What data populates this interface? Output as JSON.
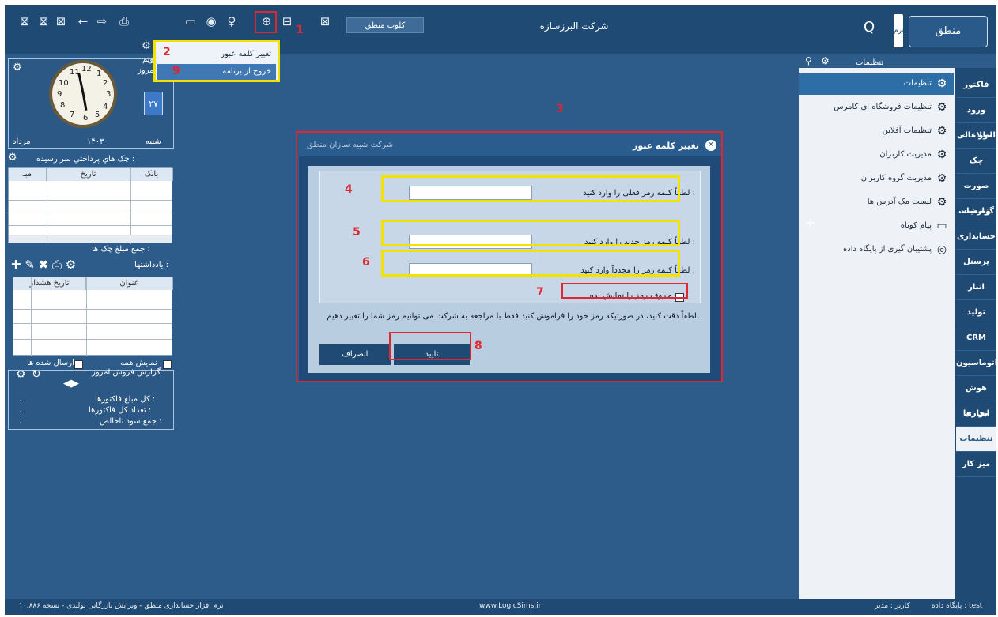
{
  "topbar": {
    "app_title": "شرکت البرزسازه",
    "club_button": "کلوب منطق",
    "logo_text": "منطق",
    "logo_strip": "نرم افزار",
    "icons": [
      "grid-icon",
      "grid-icon",
      "grid-icon",
      "arrow-left-icon",
      "arrow-right-icon",
      "printer-icon",
      "monitor-icon",
      "gamepad-icon",
      "bulb-icon",
      "lock-icon",
      "database-icon",
      "export-icon",
      "search-icon"
    ]
  },
  "user_menu": {
    "items": [
      {
        "label": "تغییر کلمه عبور",
        "selected": false
      },
      {
        "label": "خروج از برنامه",
        "selected": true
      }
    ]
  },
  "annotations": {
    "n1": "1",
    "n2": "2",
    "n3": "3",
    "n4": "4",
    "n5": "5",
    "n6": "6",
    "n7": "7",
    "n8": "8",
    "n9": "9"
  },
  "left_panel": {
    "calendar_label": "تقویم",
    "today_label": "امروز :",
    "day_name": "شنبه",
    "day_number": "۲۷",
    "month_name": "مرداد",
    "year": "۱۴۰۳",
    "cheques_title": "چک هاي پرداختي سر رسيده :",
    "cheques_headers": [
      "بانک",
      "تاريخ",
      "مبـ"
    ],
    "cheques_total_label": "جمع مبلغ چک ها :",
    "notes_title": "يادداشتها :",
    "notes_headers": [
      "عنوان",
      "تاريخ هشدار"
    ],
    "show_all_label": "نمايش همه",
    "sent_label": "ارسال شده ها",
    "sales_title": "گزارش فروش امروز",
    "sales_lines": [
      "کل مبلغ فاکتورها :",
      "تعداد کل فاکتورها :",
      "جمع سود ناخالص :"
    ],
    "sales_values": [
      ".",
      ".",
      "."
    ]
  },
  "settings_panel": {
    "header": "تنظیمات",
    "items": [
      {
        "label": "تنظیمات",
        "icon": "gear-icon",
        "highlighted": true
      },
      {
        "label": "تنظیمات فروشگاه ای کامرس",
        "icon": "gear-icon",
        "highlighted": false
      },
      {
        "label": "تنظیمات آفلاین",
        "icon": "gear-icon",
        "highlighted": false
      },
      {
        "label": "مدیریت کاربران",
        "icon": "gears-icon",
        "highlighted": false
      },
      {
        "label": "مدیریت گروه کاربران",
        "icon": "gears-icon",
        "highlighted": false
      },
      {
        "label": "لیست مک آدرس ها",
        "icon": "gears-icon",
        "highlighted": false
      },
      {
        "label": "پیام کوتاه",
        "icon": "chat-icon",
        "highlighted": false
      },
      {
        "label": "پشتیبان گیری از پایگاه داده",
        "icon": "backup-icon",
        "highlighted": false
      }
    ]
  },
  "nav_tabs": [
    "فاکتور",
    "ورود اطلاعات",
    "امور مالی",
    "چک",
    "صورت وضعیت",
    "گزارشات",
    "حسابداری",
    "پرسنل",
    "انبار",
    "تولید",
    "CRM",
    "اتوماسیون",
    "هوش تجاری",
    "ابزارها",
    "تنظیمات",
    "میز کار"
  ],
  "nav_active_index": 14,
  "dialog": {
    "title": "تغییر کلمه عبور",
    "subtitle": "شرکت شبیه سازان منطق",
    "current_label": "لطفاً کلمه رمز فعلی را وارد کنید :",
    "new_label": "لطفاً کلمه رمز جدید را وارد کنید :",
    "confirm_label": "لطفاً کلمه رمز را مجدداً وارد کنید :",
    "current_value": "",
    "new_value": "",
    "confirm_value": "",
    "show_password_label": "حروف رمز را نمایش بده",
    "show_password_checked": false,
    "note": "لطفاً دقت کنید، در صورتیکه رمز خود را فراموش کنید فقط با مراجعه به شرکت می توانیم رمز شما را تغییر دهیم.",
    "ok_label": "تایید",
    "cancel_label": "انصراف"
  },
  "status_bar": {
    "left": "نرم افزار حسابداری منطق - ویرایش بازرگانی تولیدی - نسخه ۱۰،۸۸۶",
    "center": "www.LogicSims.ir",
    "user": "کاربر : مدیر",
    "db": "پایگاه داده : test"
  },
  "colors": {
    "app_bg": "#2e5c8a",
    "dark": "#1f4a74",
    "annotation_red": "#e0262e",
    "annotation_yellow": "#f2e200"
  }
}
